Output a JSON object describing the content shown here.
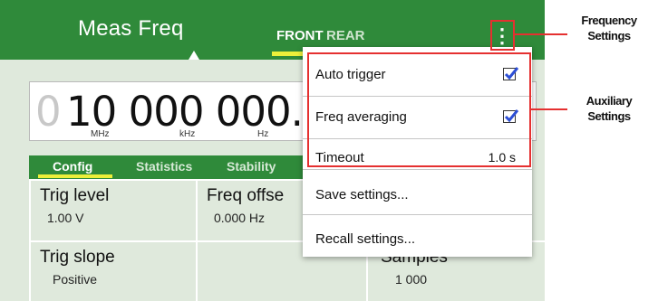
{
  "header": {
    "title": "Meas Freq",
    "tabs": [
      "FRONT",
      "REAR"
    ],
    "menu_icon": "kebab-menu-icon"
  },
  "display": {
    "lead_digit": "0",
    "digits": "10 000 000.",
    "units": [
      "MHz",
      "kHz",
      "Hz"
    ]
  },
  "tabs": [
    "Config",
    "Statistics",
    "Stability"
  ],
  "params": [
    {
      "label": "Trig level",
      "value": "1.00 V"
    },
    {
      "label": "Freq offse",
      "value": "0.000 Hz"
    },
    {
      "label": "Trig slope",
      "value": "Positive"
    },
    {
      "label": "Samples",
      "value": "1 000"
    }
  ],
  "menu": {
    "auto_trigger": {
      "label": "Auto trigger",
      "checked": true
    },
    "freq_averaging": {
      "label": "Freq averaging",
      "checked": true
    },
    "timeout": {
      "label": "Timeout",
      "value": "1.0 s"
    },
    "save": "Save settings...",
    "recall": "Recall settings..."
  },
  "callouts": {
    "frequency": {
      "line1": "Frequency",
      "line2": "Settings"
    },
    "auxiliary": {
      "line1": "Auxiliary",
      "line2": "Settings"
    }
  },
  "colors": {
    "header_green": "#2f8a3a",
    "panel_green": "#dfe9dc",
    "accent_yellow": "#ecef3a",
    "callout_red": "#e53030",
    "checkbox_blue": "#2d4fd6"
  }
}
